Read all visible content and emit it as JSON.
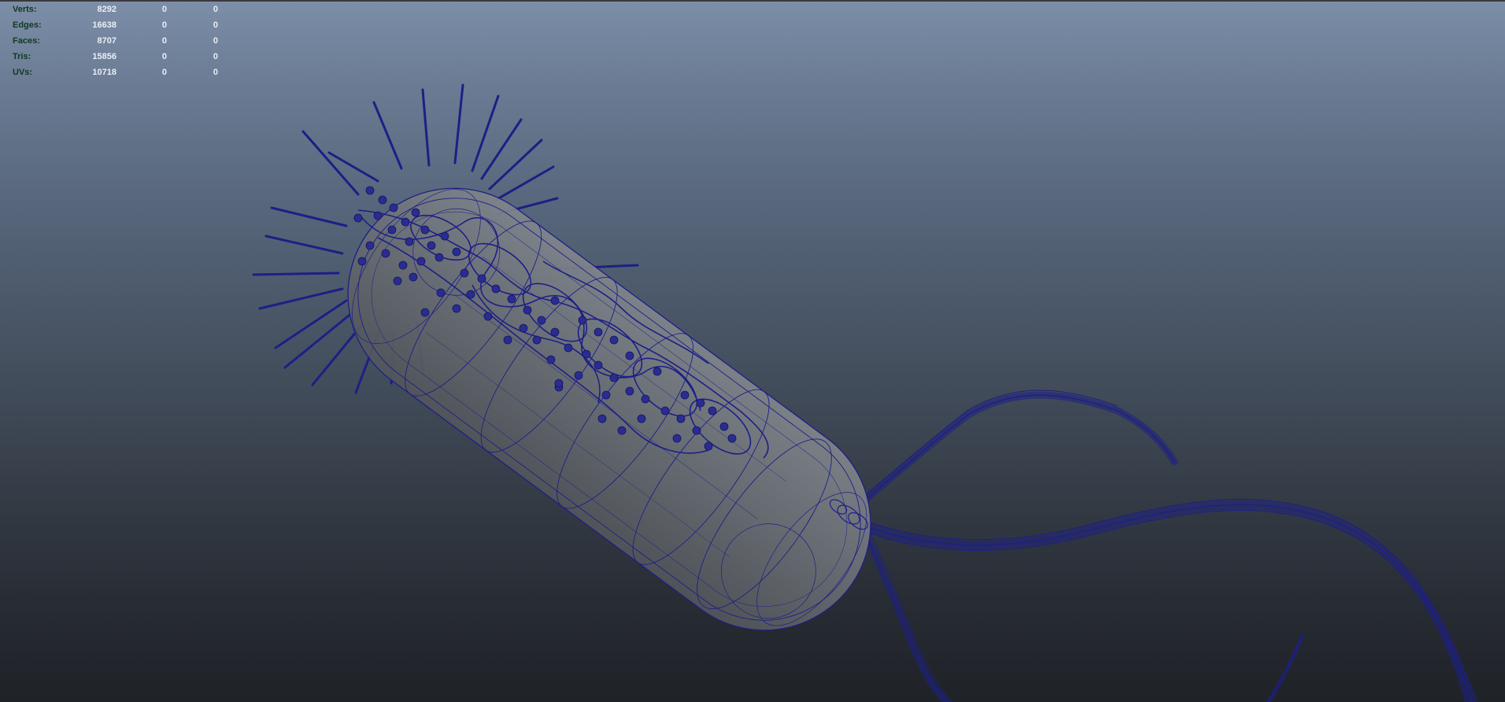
{
  "hud": {
    "rows": [
      {
        "label": "Verts:",
        "v1": "8292",
        "v2": "0",
        "v3": "0"
      },
      {
        "label": "Edges:",
        "v1": "16638",
        "v2": "0",
        "v3": "0"
      },
      {
        "label": "Faces:",
        "v1": "8707",
        "v2": "0",
        "v3": "0"
      },
      {
        "label": "Tris:",
        "v1": "15856",
        "v2": "0",
        "v3": "0"
      },
      {
        "label": "UVs:",
        "v1": "10718",
        "v2": "0",
        "v3": "0"
      }
    ]
  },
  "colors": {
    "wire": "#1d1f86",
    "body_fill": "#6f747a",
    "hud_label": "#0f3a1f",
    "hud_value": "#e9eef5"
  }
}
